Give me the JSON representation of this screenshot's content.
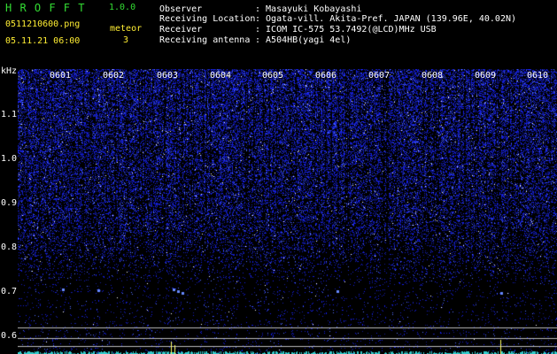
{
  "header": {
    "app_title": "H R O F F T",
    "version": "1.0.0",
    "filename": "0511210600.png",
    "datetime": "05.11.21 06:00",
    "meteor_label": "meteor",
    "meteor_count": "3",
    "info": [
      {
        "label": "Observer",
        "value": ": Masayuki Kobayashi"
      },
      {
        "label": "Receiving Location",
        "value": ": Ogata-vill. Akita-Pref. JAPAN (139.96E, 40.02N)"
      },
      {
        "label": "Receiver",
        "value": ": ICOM IC-575 53.7492(@LCD)MHz USB"
      },
      {
        "label": "Receiving antenna",
        "value": ": A504HB(yagi 4el)"
      }
    ]
  },
  "spectrogram": {
    "y_unit": "kHz",
    "y_ticks": [
      "1.1",
      "1.0",
      "0.9",
      "0.8",
      "0.7",
      "0.6"
    ],
    "time_labels": [
      "0601",
      "0602",
      "0603",
      "0604",
      "0605",
      "0606",
      "0607",
      "0608",
      "0609",
      "0610"
    ],
    "colors": {
      "noise": "#1a2aff",
      "bright": "#ffffff",
      "cyan": "#33ffff",
      "ref_line": "#bbbbbb"
    }
  }
}
